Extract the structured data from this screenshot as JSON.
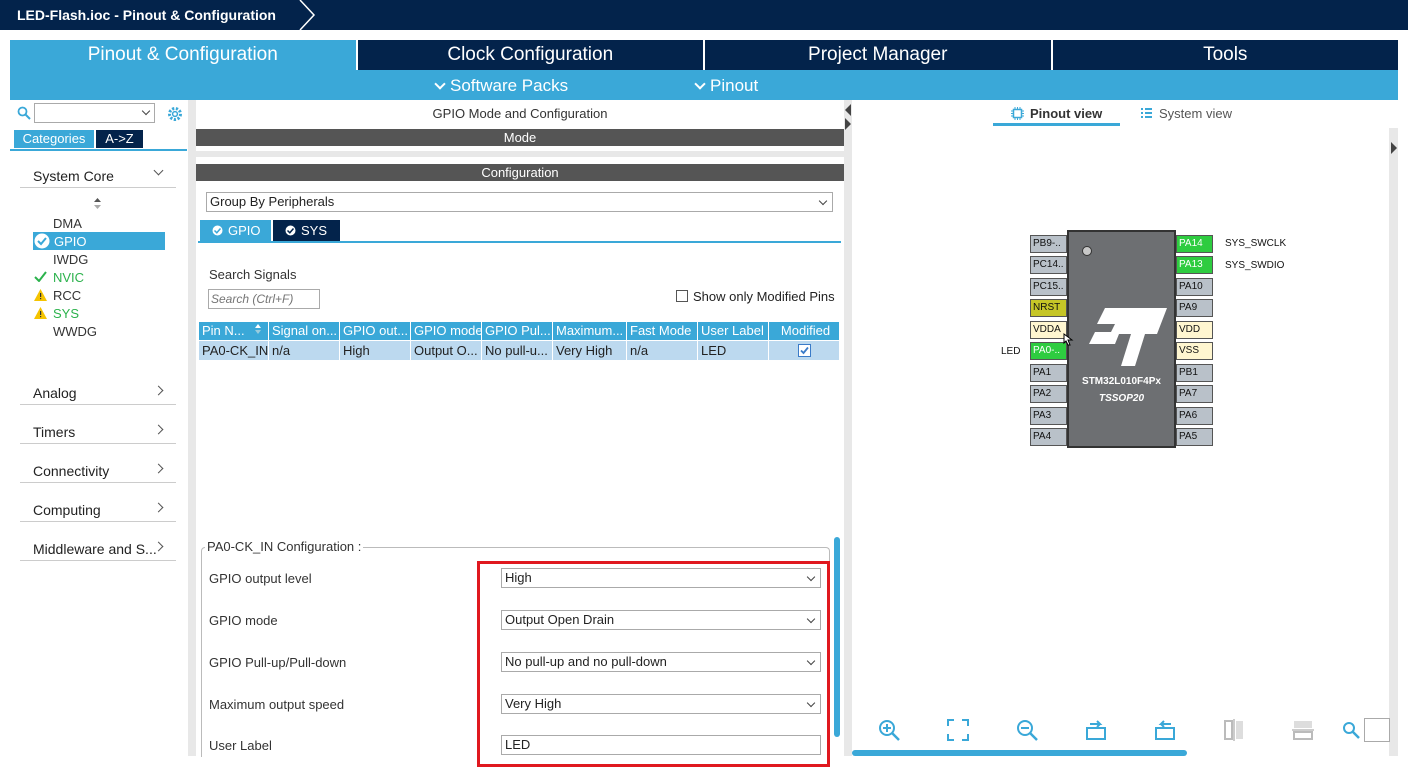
{
  "window": {
    "title": "LED-Flash.ioc - Pinout & Configuration"
  },
  "tabs": [
    "Pinout & Configuration",
    "Clock Configuration",
    "Project Manager",
    "Tools"
  ],
  "subnav": [
    "Software Packs",
    "Pinout"
  ],
  "left": {
    "cat_tabs": [
      "Categories",
      "A->Z"
    ],
    "system_core": "System Core",
    "system_core_items": [
      "DMA",
      "GPIO",
      "IWDG",
      "NVIC",
      "RCC",
      "SYS",
      "WWDG"
    ],
    "categories": [
      "Analog",
      "Timers",
      "Connectivity",
      "Computing",
      "Middleware and S..."
    ]
  },
  "middle": {
    "title": "GPIO Mode and Configuration",
    "mode_header": "Mode",
    "config_header": "Configuration",
    "group_select": "Group By Peripherals",
    "periph_tabs": [
      "GPIO",
      "SYS"
    ],
    "search_label": "Search Signals",
    "search_placeholder": "Search (Ctrl+F)",
    "show_modified": "Show only Modified Pins",
    "columns": [
      "Pin N...",
      "Signal on...",
      "GPIO out...",
      "GPIO mode",
      "GPIO Pul...",
      "Maximum...",
      "Fast Mode",
      "User Label",
      "Modified"
    ],
    "row": [
      "PA0-CK_IN",
      "n/a",
      "High",
      "Output O...",
      "No pull-u...",
      "Very High",
      "n/a",
      "LED"
    ],
    "pin_config_title": "PA0-CK_IN Configuration :",
    "fields": [
      {
        "label": "GPIO output level",
        "value": "High"
      },
      {
        "label": "GPIO mode",
        "value": "Output Open Drain"
      },
      {
        "label": "GPIO Pull-up/Pull-down",
        "value": "No pull-up and no pull-down"
      },
      {
        "label": "Maximum output speed",
        "value": "Very High"
      },
      {
        "label": "User Label",
        "value": "LED"
      }
    ]
  },
  "right": {
    "views": [
      "Pinout view",
      "System view"
    ],
    "chip_name": "STM32L010F4Px",
    "package": "TSSOP20",
    "left_pins": [
      "PB9-..",
      "PC14..",
      "PC15..",
      "NRST",
      "VDDA",
      "PA0-..",
      "PA1",
      "PA2",
      "PA3",
      "PA4"
    ],
    "right_pins": [
      "PA14",
      "PA13",
      "PA10",
      "PA9",
      "VDD",
      "VSS",
      "PB1",
      "PA7",
      "PA6",
      "PA5"
    ],
    "labels": {
      "pa14": "SYS_SWCLK",
      "pa13": "SYS_SWDIO",
      "pa0": "LED"
    }
  },
  "colors": {
    "navy": "#03234b",
    "accent": "#3aa8d8",
    "highlight": "#e0181f"
  }
}
